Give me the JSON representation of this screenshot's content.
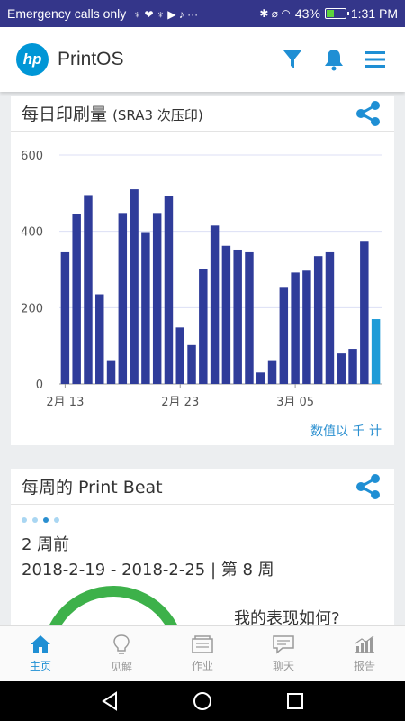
{
  "status_bar": {
    "left_text": "Emergency calls only",
    "notif_icons": "♆ ❤ ♆ ▶ ♪ ···",
    "right_icons": "✱ ⌀ ◠",
    "battery_percent": "43%",
    "battery_level": 0.43,
    "time": "1:31 PM"
  },
  "app_bar": {
    "logo_text": "hp",
    "title": "PrintOS",
    "icons": [
      "filter-icon",
      "bell-icon",
      "menu-icon"
    ]
  },
  "daily_card": {
    "title": "每日印刷量",
    "subtitle": "(SRA3 次压印)",
    "units_link": "数值以 千 计"
  },
  "chart_data": {
    "type": "bar",
    "title": "每日印刷量 (SRA3 次压印)",
    "ylim": [
      0,
      600
    ],
    "yticks": [
      0,
      200,
      400,
      600
    ],
    "grid": true,
    "xtick_labels": [
      {
        "index": 0,
        "label": "2月 13"
      },
      {
        "index": 10,
        "label": "2月 23"
      },
      {
        "index": 20,
        "label": "3月 05"
      }
    ],
    "values": [
      345,
      445,
      495,
      235,
      60,
      448,
      510,
      398,
      448,
      492,
      148,
      102,
      302,
      415,
      362,
      352,
      345,
      30,
      60,
      252,
      292,
      297,
      335,
      345,
      80,
      92,
      375,
      170
    ],
    "highlight_index": 27,
    "colors": {
      "bar": "#2f3c9a",
      "highlight": "#1e9bd7",
      "grid": "#dcdff5",
      "axis": "#999999"
    }
  },
  "weekly_card": {
    "title": "每周的 Print Beat",
    "pager_dots": 4,
    "active_dot": 2,
    "weeks_ago": "2 周前",
    "date_range": "2018-2-19 - 2018-2-25 | 第 8 周",
    "question": "我的表现如何?",
    "gauge_color": "#3db14a"
  },
  "bottom_nav": {
    "items": [
      {
        "label": "主页",
        "icon": "home-icon",
        "active": true
      },
      {
        "label": "见解",
        "icon": "lightbulb-icon",
        "active": false
      },
      {
        "label": "作业",
        "icon": "jobs-icon",
        "active": false
      },
      {
        "label": "聊天",
        "icon": "chat-icon",
        "active": false
      },
      {
        "label": "报告",
        "icon": "report-icon",
        "active": false
      }
    ]
  },
  "system_nav": [
    "back-icon",
    "home-circle-icon",
    "recents-icon"
  ]
}
